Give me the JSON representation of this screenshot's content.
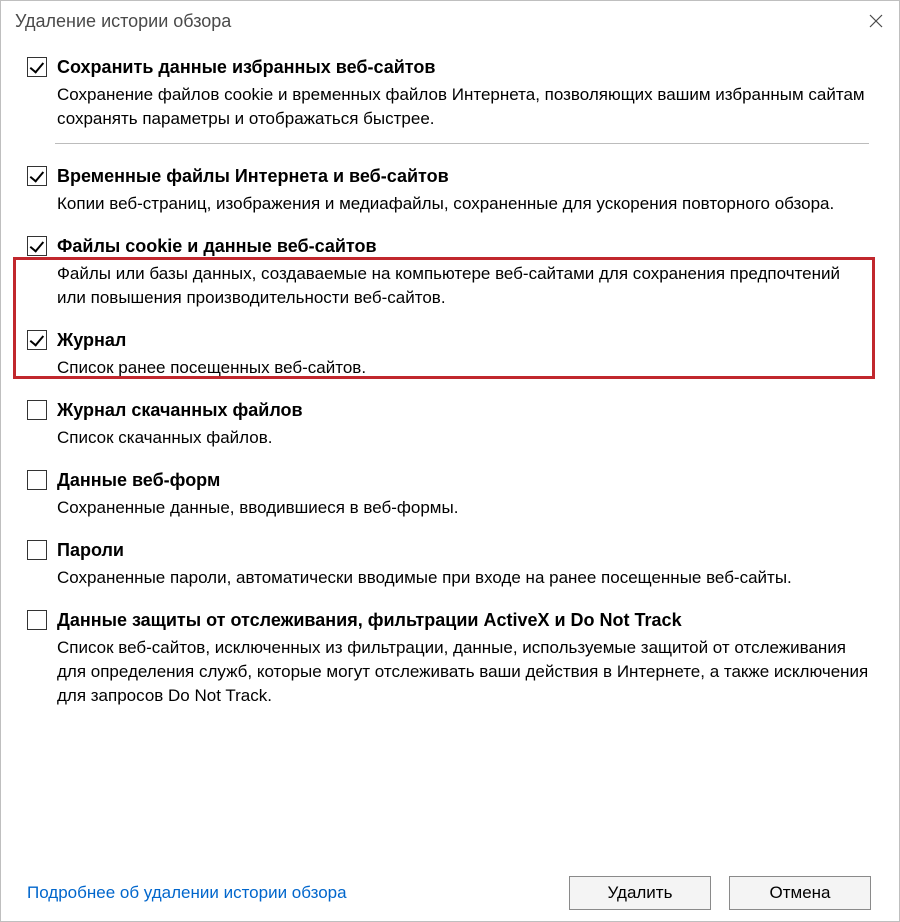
{
  "window": {
    "title": "Удаление истории обзора"
  },
  "options": [
    {
      "checked": true,
      "label": "Сохранить данные избранных веб-сайтов",
      "desc": "Сохранение файлов cookie и временных файлов Интернета, позволяющих вашим избранным сайтам сохранять параметры и отображаться быстрее."
    },
    {
      "checked": true,
      "label": "Временные файлы Интернета и веб-сайтов",
      "desc": "Копии веб-страниц, изображения и медиафайлы, сохраненные для ускорения повторного обзора."
    },
    {
      "checked": true,
      "label": "Файлы cookie и данные веб-сайтов",
      "desc": "Файлы или базы данных, создаваемые на компьютере веб-сайтами для сохранения предпочтений или повышения производительности веб-сайтов."
    },
    {
      "checked": true,
      "label": "Журнал",
      "desc": "Список ранее посещенных веб-сайтов."
    },
    {
      "checked": false,
      "label": "Журнал скачанных файлов",
      "desc": "Список скачанных файлов."
    },
    {
      "checked": false,
      "label": "Данные веб-форм",
      "desc": "Сохраненные данные, вводившиеся в веб-формы."
    },
    {
      "checked": false,
      "label": "Пароли",
      "desc": "Сохраненные пароли, автоматически вводимые при входе на ранее посещенные веб-сайты."
    },
    {
      "checked": false,
      "label": "Данные защиты от отслеживания, фильтрации ActiveX и Do Not Track",
      "desc": "Список веб-сайтов, исключенных из фильтрации, данные, используемые защитой от отслеживания для определения служб, которые могут отслеживать ваши действия в Интернете, а также исключения для запросов Do Not Track."
    }
  ],
  "footer": {
    "more_link": "Подробнее об удалении истории обзора",
    "delete": "Удалить",
    "cancel": "Отмена"
  }
}
